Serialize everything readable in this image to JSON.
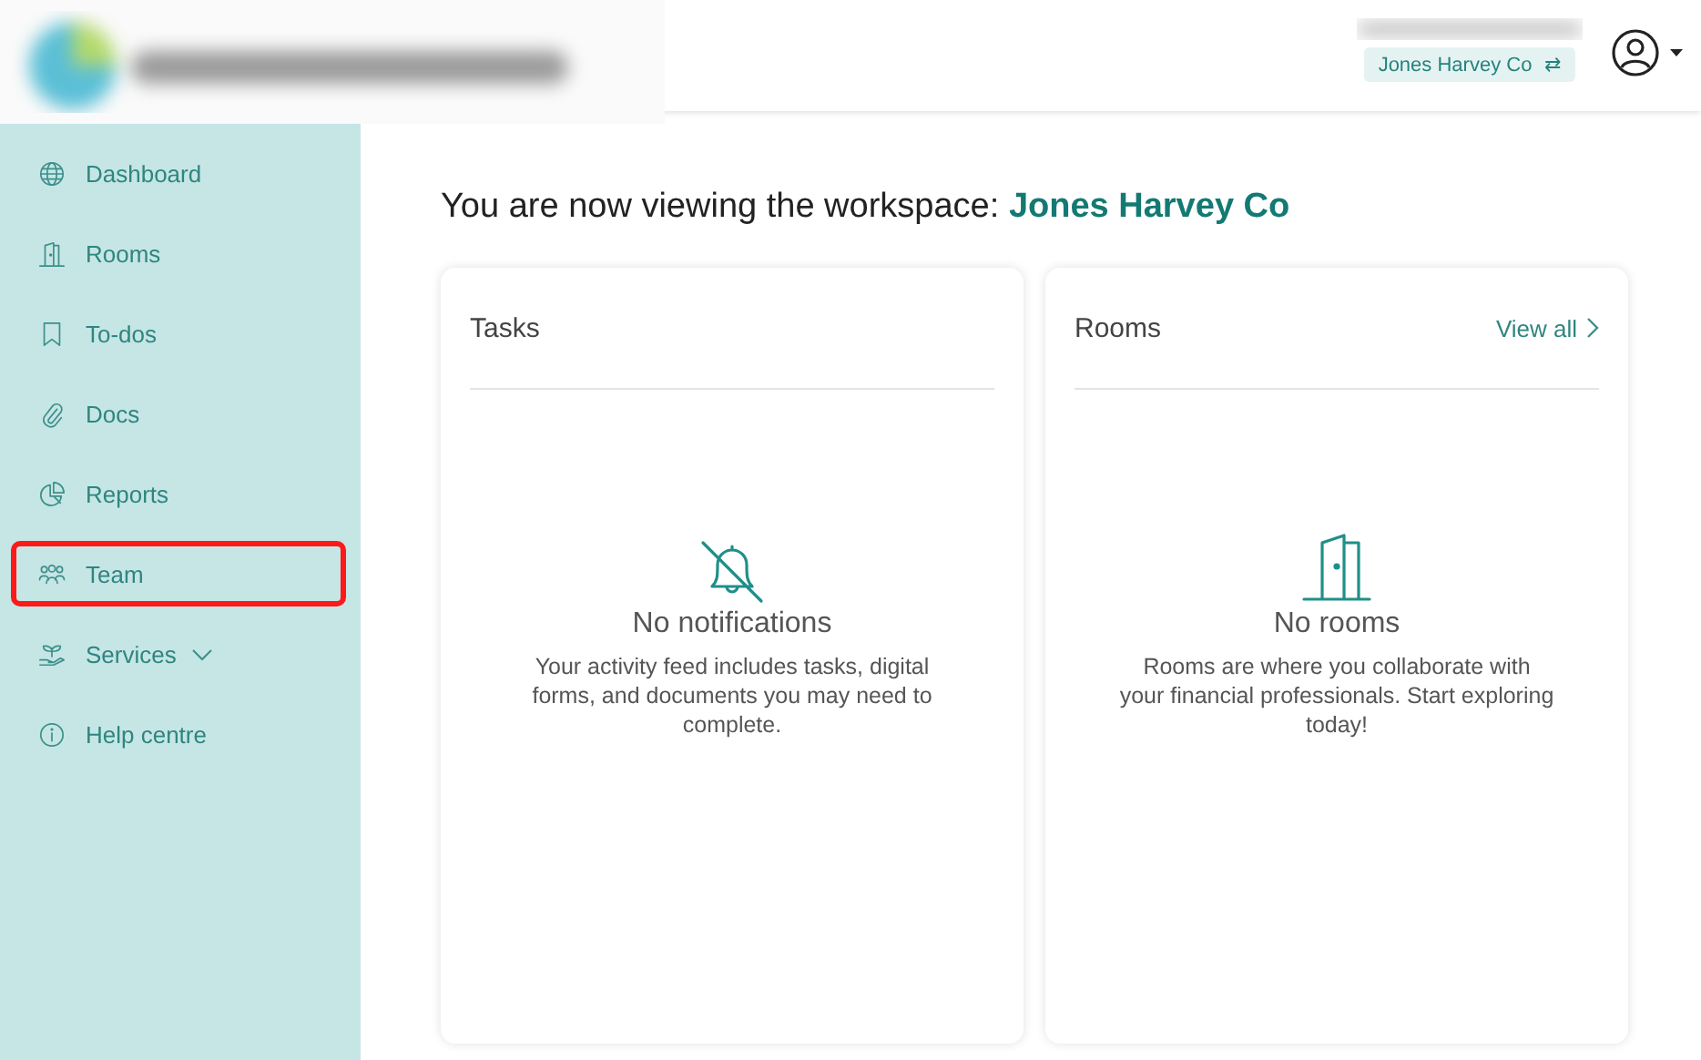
{
  "header": {
    "workspace_badge": {
      "label": "Jones Harvey Co",
      "icon": "⇄"
    }
  },
  "sidebar": {
    "items": [
      {
        "label": "Dashboard",
        "kind": "globe",
        "highlighted": false,
        "expandable": false
      },
      {
        "label": "Rooms",
        "kind": "door",
        "highlighted": false,
        "expandable": false
      },
      {
        "label": "To-dos",
        "kind": "bookmark",
        "highlighted": false,
        "expandable": false
      },
      {
        "label": "Docs",
        "kind": "paperclip",
        "highlighted": false,
        "expandable": false
      },
      {
        "label": "Reports",
        "kind": "pie",
        "highlighted": false,
        "expandable": false
      },
      {
        "label": "Team",
        "kind": "people",
        "highlighted": true,
        "expandable": false
      },
      {
        "label": "Services",
        "kind": "plant",
        "highlighted": false,
        "expandable": true
      },
      {
        "label": "Help centre",
        "kind": "info",
        "highlighted": false,
        "expandable": false
      }
    ]
  },
  "main": {
    "heading": "You are now viewing the workspace: **Jones Harvey Co**",
    "cards": [
      {
        "title": "Tasks",
        "kind": "notifications",
        "empty_title": "No notifications",
        "empty_text": "Your activity feed includes tasks, digital forms, and documents you may need to complete."
      },
      {
        "title": "Rooms",
        "link": "View all",
        "kind": "rooms",
        "empty_title": "No rooms",
        "empty_text": "Rooms are where you collaborate with your financial professionals. Start exploring today!"
      }
    ]
  }
}
